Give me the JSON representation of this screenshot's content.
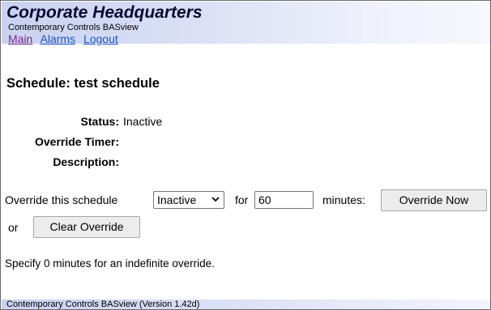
{
  "header": {
    "title": "Corporate Headquarters",
    "subtitle": "Contemporary Controls BASview",
    "nav": {
      "main": "Main",
      "alarms": "Alarms",
      "logout": "Logout"
    }
  },
  "schedule": {
    "heading": "Schedule: test schedule",
    "status_label": "Status:",
    "status_value": "Inactive",
    "override_timer_label": "Override Timer:",
    "override_timer_value": "",
    "description_label": "Description:",
    "description_value": ""
  },
  "override": {
    "prefix": "Override this schedule",
    "selected_state": "Inactive",
    "for_label": "for",
    "minutes_value": "60",
    "minutes_label": "minutes:",
    "override_button": "Override Now",
    "or_label": "or",
    "clear_button": "Clear Override",
    "hint": "Specify 0 minutes for an indefinite override."
  },
  "footer": {
    "text": "Contemporary Controls BASview (Version 1.42d)"
  }
}
